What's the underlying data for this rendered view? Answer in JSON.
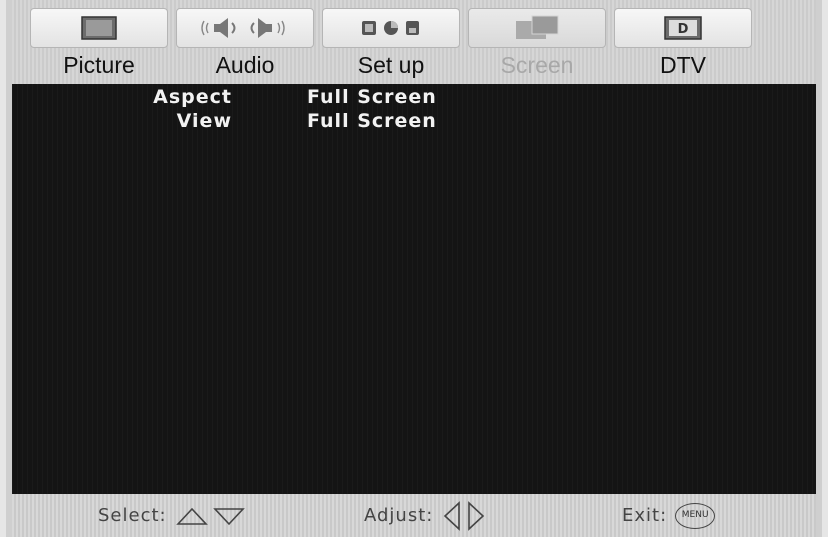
{
  "tabs": [
    {
      "label": "Picture",
      "icon": "tv-screen-icon",
      "selected": false
    },
    {
      "label": "Audio",
      "icon": "speaker-icon",
      "selected": false
    },
    {
      "label": "Set up",
      "icon": "setup-icon",
      "selected": false
    },
    {
      "label": "Screen",
      "icon": "screen-aspect-icon",
      "selected": true
    },
    {
      "label": "DTV",
      "icon": "dtv-icon",
      "selected": false
    }
  ],
  "menu": {
    "items": [
      {
        "label": "Aspect",
        "value": "Full Screen"
      },
      {
        "label": "View",
        "value": "Full Screen"
      }
    ]
  },
  "help": {
    "select_label": "Select:",
    "adjust_label": "Adjust:",
    "exit_label": "Exit:",
    "menu_key": "MENU"
  },
  "colors": {
    "background": "#141414",
    "text": "#f2f2f2",
    "selected_tab_text": "#a8a8a8",
    "bar": "#cfcfcf"
  }
}
